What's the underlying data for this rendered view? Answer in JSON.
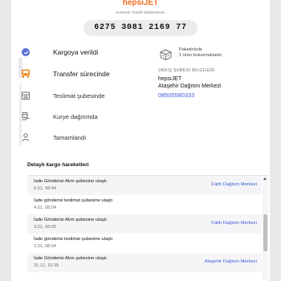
{
  "header": {
    "brand": "hepsiJET",
    "subtitle": "KARGO TAKİP NUMARASI",
    "tracking_number": "6275 3081 2169 77"
  },
  "steps": [
    {
      "label": "Kargoya verildi",
      "status": "done",
      "icon": "check-circle-icon"
    },
    {
      "label": "Transfer sürecinde",
      "status": "current",
      "icon": "truck-icon"
    },
    {
      "label": "Teslimat şubesinde",
      "status": "pending",
      "icon": "warehouse-icon"
    },
    {
      "label": "Kurye dağıtımda",
      "status": "pending",
      "icon": "courier-icon"
    },
    {
      "label": "Tamamlandı",
      "status": "pending",
      "icon": "person-icon"
    }
  ],
  "package": {
    "line1": "Paketinizde",
    "line2": "1 ürün bulunmaktadır."
  },
  "branch": {
    "heading": "VARIŞ ŞUBESİ BİLGİLERİ",
    "company": "hepsiJET",
    "name": "Ataşehir Dağıtım Merkezi",
    "phone": "08505580333"
  },
  "movements": {
    "heading": "Detaylı kargo hareketleri",
    "rows": [
      {
        "title": "İade Gönderisi Alım şubesine ulaştı",
        "date": "6.01, 08:44",
        "branch": "Fatih Dağıtım Merkezi"
      },
      {
        "title": "İade gönderisi teslimat şubesine ulaştı",
        "date": "4.01, 08:04",
        "branch": ""
      },
      {
        "title": "İade Gönderisi Alım şubesine ulaştı",
        "date": "3.01, 08:06",
        "branch": "Fatih Dağıtım Merkezi"
      },
      {
        "title": "İade gönderisi teslimat şubesine ulaştı",
        "date": "2.01, 08:04",
        "branch": ""
      },
      {
        "title": "İade Gönderisi Alım şubesine ulaştı",
        "date": "31.12, 10:39",
        "branch": "Ataşehir Dağıtım Merkezi"
      }
    ]
  },
  "colors": {
    "brand": "#f26b1d",
    "accent": "#5b6fd6",
    "link": "#3b5bd9"
  }
}
